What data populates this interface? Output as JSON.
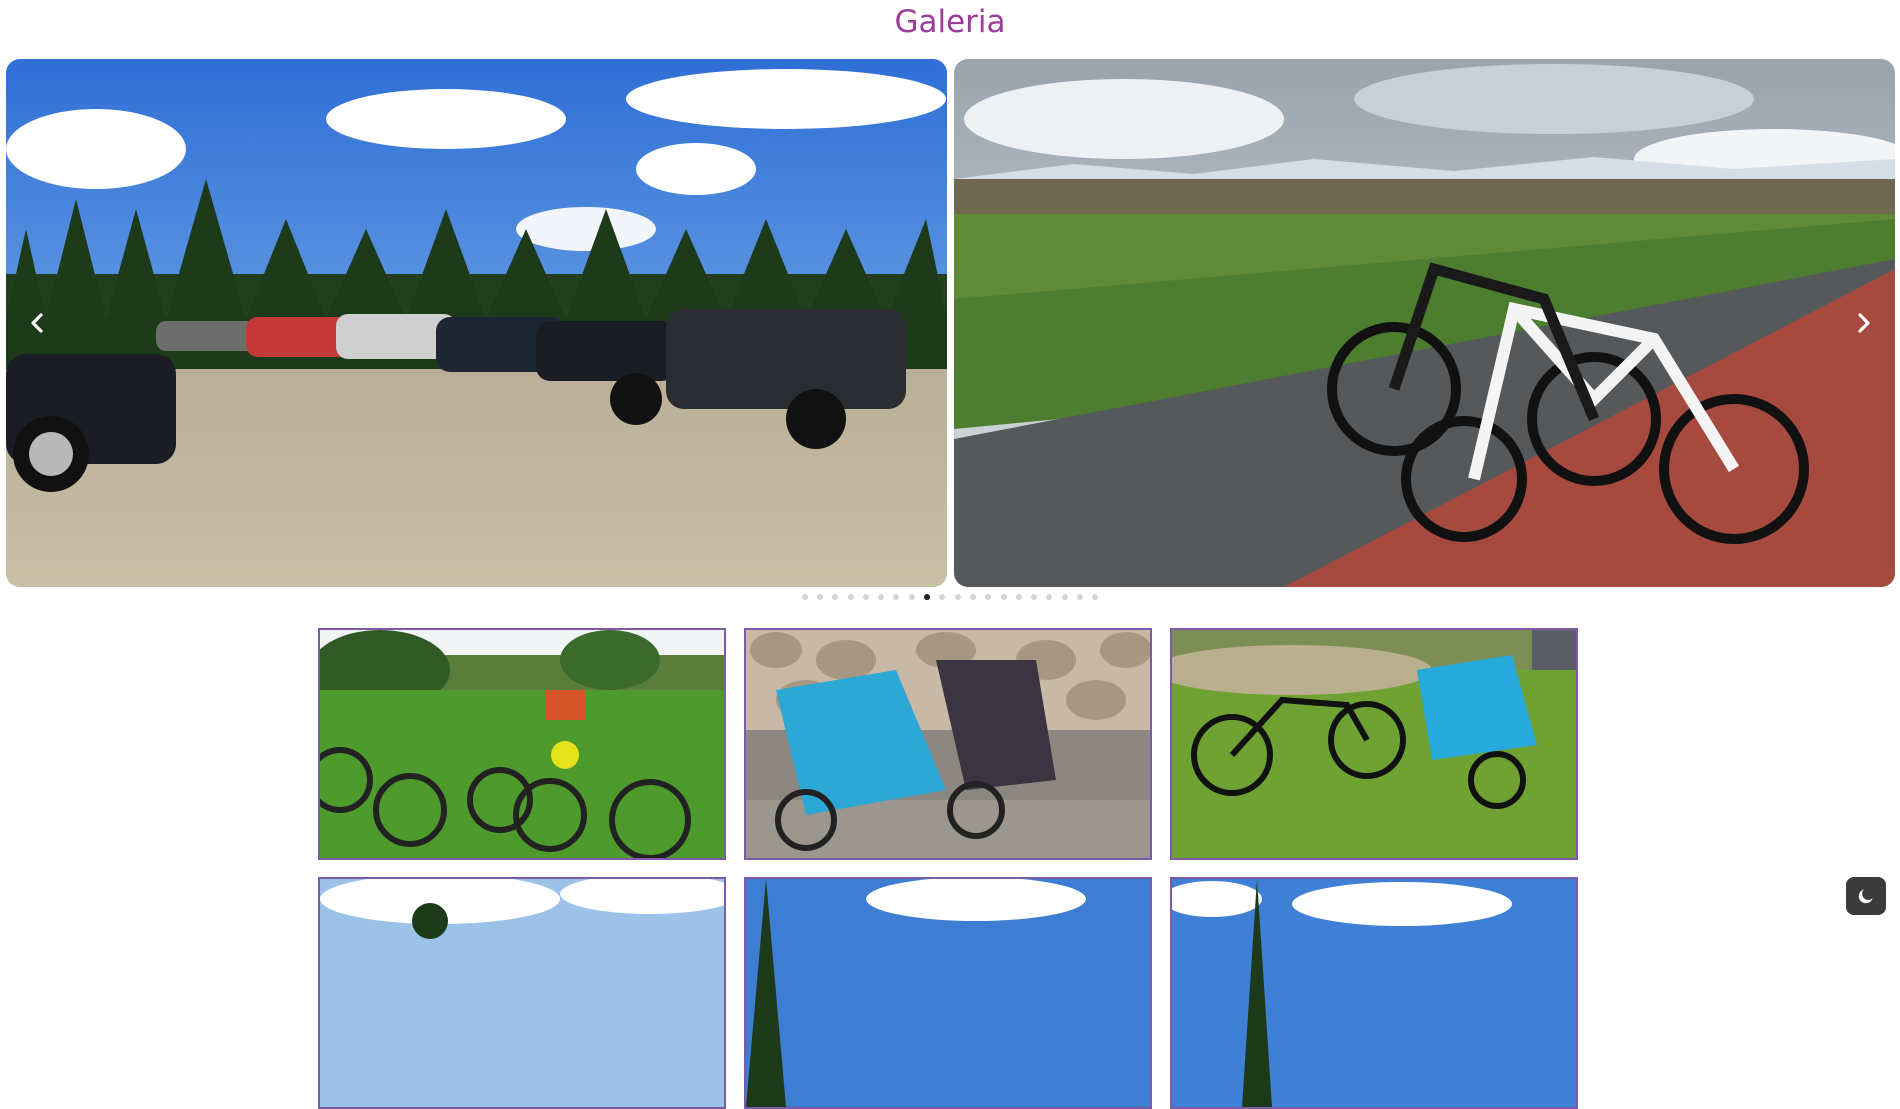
{
  "page": {
    "title": "Galeria"
  },
  "carousel": {
    "slide_count": 20,
    "active_index": 8,
    "slides": [
      {
        "icon": "photo-parking-lot"
      },
      {
        "icon": "photo-bicycles-path"
      }
    ],
    "prev_icon": "chevron-left-icon",
    "next_icon": "chevron-right-icon"
  },
  "thumbnails": [
    {
      "icon": "photo-bikes-on-grass"
    },
    {
      "icon": "photo-bike-trailers"
    },
    {
      "icon": "photo-bike-with-trailer"
    },
    {
      "icon": "photo-sky-trees"
    },
    {
      "icon": "photo-sky-trees"
    },
    {
      "icon": "photo-sky-trees"
    }
  ],
  "theme_toggle": {
    "icon": "moon-icon"
  },
  "colors": {
    "title": "#9a3c9a",
    "thumb_border": "#7c5aa6",
    "dot_active": "#1f1f1f",
    "dot_inactive": "#d4d4d4"
  }
}
